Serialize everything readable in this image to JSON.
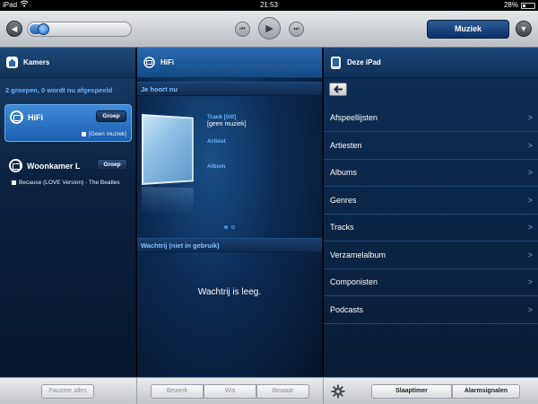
{
  "status_bar": {
    "device": "iPad",
    "time": "21:53",
    "battery": "28%"
  },
  "toolbar": {
    "volume_fraction": 0.12,
    "music_button": "Muziek"
  },
  "rooms_panel": {
    "title": "Kamers",
    "status": "2 groepen, 0 wordt nu afgespeeld",
    "rooms": [
      {
        "name": "HiFi",
        "group_label": "Groep",
        "track": "[Geen muziek]",
        "active": true
      },
      {
        "name": "Woonkamer L",
        "group_label": "Groep",
        "track": "Because (LOVE Version) - The Beatles",
        "active": false
      }
    ]
  },
  "now_playing_panel": {
    "title": "HiFi",
    "section_now": "Je hoort nu",
    "track_label": "Track [0/0]",
    "track_value": "[geen muziek]",
    "artist_label": "Artiest",
    "album_label": "Album",
    "section_queue": "Wachtrij (niet in gebruik)",
    "queue_empty": "Wachtrij is leeg."
  },
  "library_panel": {
    "title": "Deze iPad",
    "items": [
      {
        "label": "Afspeellijsten"
      },
      {
        "label": "Artiesten"
      },
      {
        "label": "Albums"
      },
      {
        "label": "Genres"
      },
      {
        "label": "Tracks"
      },
      {
        "label": "Verzamelalbum"
      },
      {
        "label": "Componisten"
      },
      {
        "label": "Podcasts"
      }
    ],
    "chevron": ">"
  },
  "bottom_bar": {
    "pause_all": "Pauzeer alles",
    "edit": "Bewerk",
    "clear": "Wis",
    "save": "Bewaar",
    "sleep_timer": "Slaaptimer",
    "alarms": "Alarmsignalen"
  },
  "colors": {
    "accent": "#1c5fae",
    "link_blue": "#6fb3ff",
    "panel_bg": "#0a2647"
  }
}
